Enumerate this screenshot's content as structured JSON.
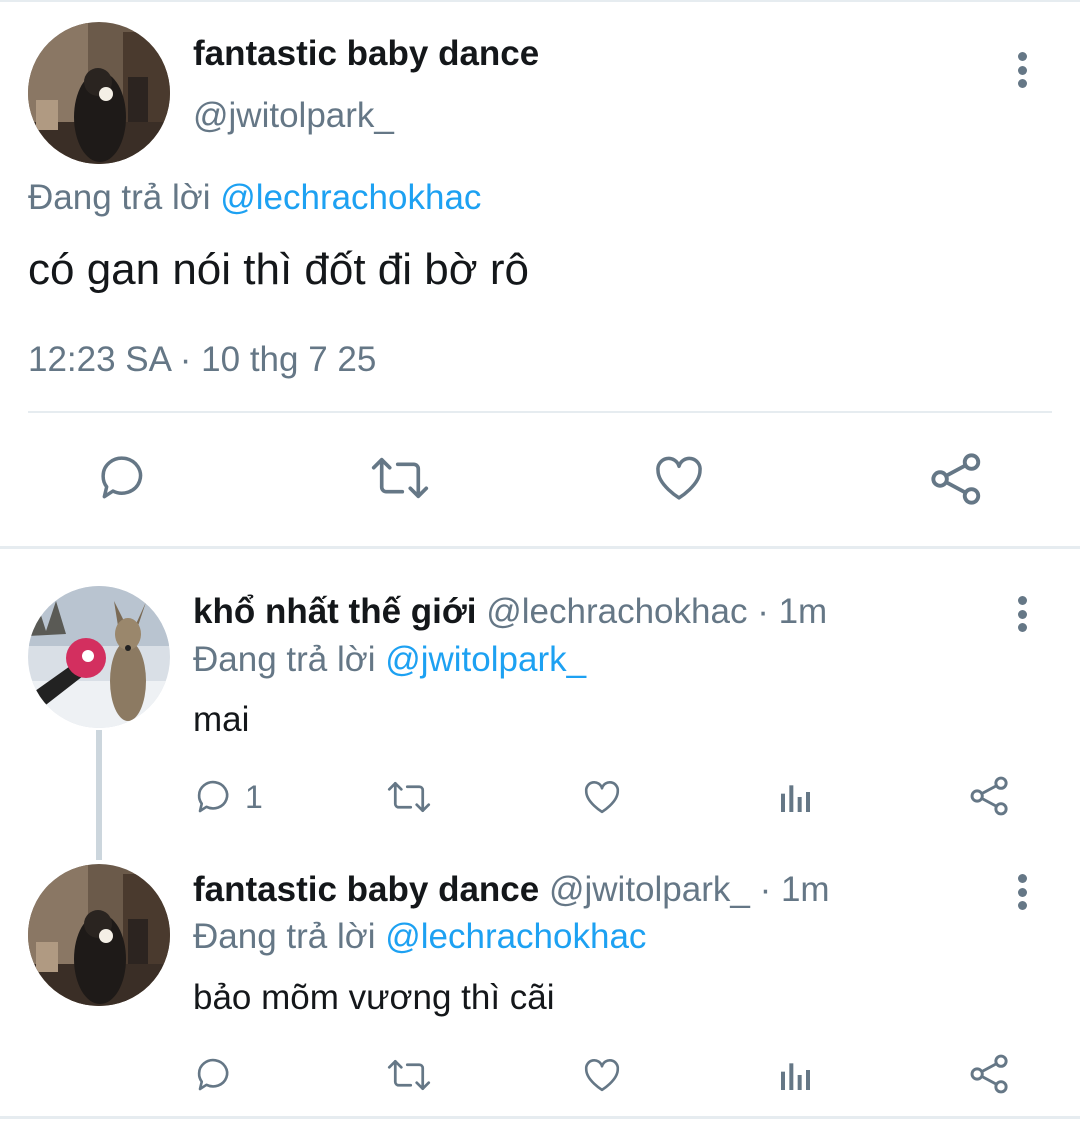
{
  "main_tweet": {
    "display_name": "fantastic baby dance",
    "handle": "@jwitolpark_",
    "replying_prefix": "Đang trả lời",
    "replying_to": "@lechrachokhac",
    "text": "có gan nói thì đốt đi bờ rô",
    "timestamp": "12:23 SA · 10 thg 7 25"
  },
  "replies": [
    {
      "display_name": "khổ nhất thế giới",
      "handle": "@lechrachokhac",
      "separator": "·",
      "time_ago": "1m",
      "replying_prefix": "Đang trả lời",
      "replying_to": "@jwitolpark_",
      "text": "mai",
      "reply_count": "1"
    },
    {
      "display_name": "fantastic baby dance",
      "handle": "@jwitolpark_",
      "separator": "·",
      "time_ago": "1m",
      "replying_prefix": "Đang trả lời",
      "replying_to": "@lechrachokhac",
      "text": "bảo mõm vương thì cãi",
      "reply_count": ""
    }
  ],
  "icons": {
    "reply": "speech-bubble-icon",
    "retweet": "retweet-icon",
    "like": "heart-icon",
    "share": "share-icon",
    "views": "bar-chart-icon",
    "more": "vertical-ellipsis-icon"
  },
  "colors": {
    "accent": "#1da1f2",
    "secondary_text": "#657786",
    "primary_text": "#14171a",
    "divider": "#e6ecf0"
  }
}
